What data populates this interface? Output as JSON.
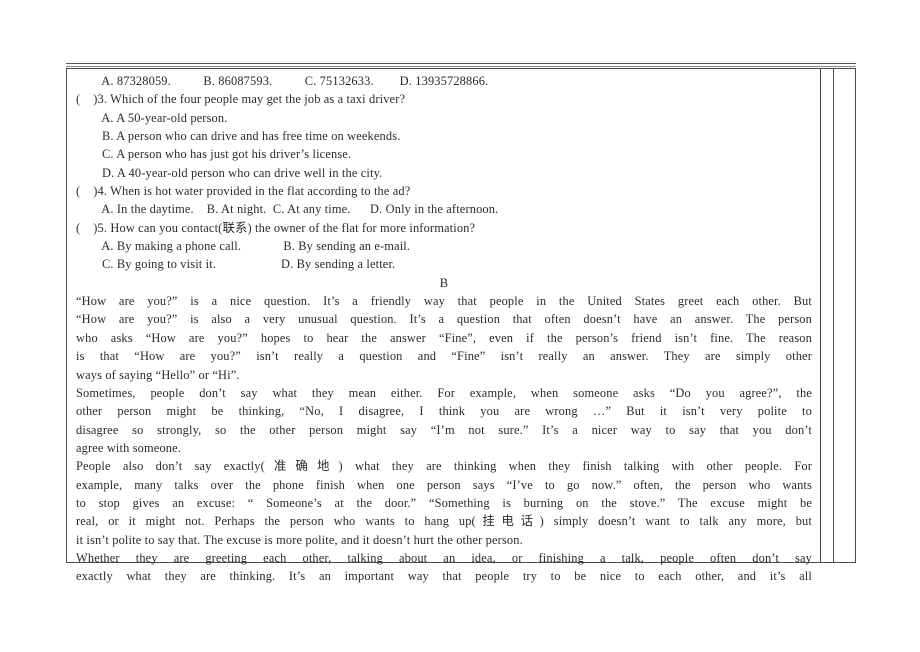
{
  "document": {
    "kind": "english-exam-reading-comprehension-page",
    "section_heading": "B"
  },
  "questions": [
    {
      "id": "q2-options",
      "type": "options-row",
      "text": "        A. 87328059.          B. 86087593.          C. 75132633.        D. 13935728866."
    },
    {
      "id": "q3",
      "type": "stem",
      "text": "(    )3. Which of the four people may get the job as a taxi driver?"
    },
    {
      "id": "q3-a",
      "type": "option",
      "text": "        A. A 50-year-old person."
    },
    {
      "id": "q3-b",
      "type": "option",
      "text": "        B. A person who can drive and has free time on weekends."
    },
    {
      "id": "q3-c",
      "type": "option",
      "text": "        C. A person who has just got his driver’s license."
    },
    {
      "id": "q3-d",
      "type": "option",
      "text": "        D. A 40-year-old person who can drive well in the city."
    },
    {
      "id": "q4",
      "type": "stem",
      "text": "(    )4. When is hot water provided in the flat according to the ad?"
    },
    {
      "id": "q4-options",
      "type": "options-row",
      "text": "        A. In the daytime.    B. At night.  C. At any time.      D. Only in the afternoon."
    },
    {
      "id": "q5",
      "type": "stem",
      "text": "(    )5. How can you contact(联系) the owner of the flat for more information?"
    },
    {
      "id": "q5-options-1",
      "type": "options-row",
      "text": "        A. By making a phone call.             B. By sending an e-mail."
    },
    {
      "id": "q5-options-2",
      "type": "options-row",
      "text": "        C. By going to visit it.                    D. By sending a letter."
    }
  ],
  "passage": {
    "label": "B",
    "paragraphs": [
      {
        "id": "p1",
        "lines": [
          "“How are you?” is a nice question. It’s a friendly way that people in the United States greet each other. But",
          "“How are you?” is also a very unusual question. It’s a question that often doesn’t have an answer. The person",
          "who asks “How are you?” hopes to hear the answer “Fine”, even if the person’s friend isn’t fine. The reason",
          "is that “How are you?” isn’t really a question and “Fine” isn’t really an answer. They are simply other",
          "ways of saying “Hello” or “Hi”."
        ],
        "last_line_flush": true
      },
      {
        "id": "p2",
        "lines": [
          "    Sometimes, people don’t say what they mean either. For example, when someone asks “Do you agree?”, the",
          "other person might be thinking, “No, I disagree, I think you are wrong …” But it isn’t very polite to",
          "disagree so strongly, so the other person might say “I’m not sure.” It’s a nicer way to say that you don’t",
          "agree with someone."
        ],
        "last_line_flush": true
      },
      {
        "id": "p3",
        "lines": [
          "    People also don’t say exactly(准确地) what they are thinking when they finish talking with other people. For",
          "example, many talks over the phone finish when one person says “I’ve to go now.” often, the person who wants",
          "to stop gives an excuse: “ Someone’s at the door.” “Something is burning on the stove.” The excuse might be",
          "real, or it might not. Perhaps the person who wants to hang up(挂电话) simply doesn’t want to talk any more, but",
          "it isn’t polite to say that. The excuse is more polite, and it doesn’t hurt the other person."
        ],
        "last_line_flush": true
      },
      {
        "id": "p4",
        "lines": [
          "    Whether they are greeting each other, talking about an idea, or finishing a talk, people often don’t say",
          "exactly what they are thinking. It’s an important way that people try to be nice to each other, and it’s all"
        ],
        "last_line_flush": true
      }
    ]
  },
  "colors": {
    "text": "#2b2b2b",
    "border": "#4a4a4a",
    "page_background": "#ffffff"
  }
}
